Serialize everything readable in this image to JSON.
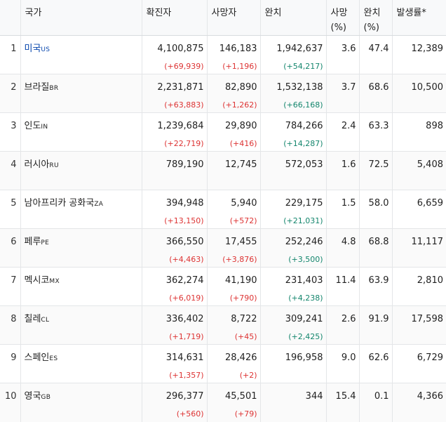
{
  "headers": {
    "country": "국가",
    "confirmed": "확진자",
    "deaths": "사망자",
    "recovered": "완치",
    "death_rate_1": "사망",
    "death_rate_2": "(%)",
    "recovery_rate_1": "완치",
    "recovery_rate_2": "(%)",
    "incidence": "발생률*"
  },
  "rows": [
    {
      "idx": "1",
      "name": "미국",
      "code": "US",
      "confirmed": "4,100,875",
      "confirmed_delta": "(+69,939)",
      "deaths": "146,183",
      "deaths_delta": "(+1,196)",
      "recovered": "1,942,637",
      "recovered_delta": "(+54,217)",
      "death_rate": "3.6",
      "recovery_rate": "47.4",
      "incidence": "12,389"
    },
    {
      "idx": "2",
      "name": "브라질",
      "code": "BR",
      "confirmed": "2,231,871",
      "confirmed_delta": "(+63,883)",
      "deaths": "82,890",
      "deaths_delta": "(+1,262)",
      "recovered": "1,532,138",
      "recovered_delta": "(+66,168)",
      "death_rate": "3.7",
      "recovery_rate": "68.6",
      "incidence": "10,500"
    },
    {
      "idx": "3",
      "name": "인도",
      "code": "IN",
      "confirmed": "1,239,684",
      "confirmed_delta": "(+22,719)",
      "deaths": "29,890",
      "deaths_delta": "(+416)",
      "recovered": "784,266",
      "recovered_delta": "(+14,287)",
      "death_rate": "2.4",
      "recovery_rate": "63.3",
      "incidence": "898"
    },
    {
      "idx": "4",
      "name": "러시아",
      "code": "RU",
      "confirmed": "789,190",
      "confirmed_delta": "",
      "deaths": "12,745",
      "deaths_delta": "",
      "recovered": "572,053",
      "recovered_delta": "",
      "death_rate": "1.6",
      "recovery_rate": "72.5",
      "incidence": "5,408"
    },
    {
      "idx": "5",
      "name": "남아프리카 공화국",
      "code": "ZA",
      "confirmed": "394,948",
      "confirmed_delta": "(+13,150)",
      "deaths": "5,940",
      "deaths_delta": "(+572)",
      "recovered": "229,175",
      "recovered_delta": "(+21,031)",
      "death_rate": "1.5",
      "recovery_rate": "58.0",
      "incidence": "6,659"
    },
    {
      "idx": "6",
      "name": "페루",
      "code": "PE",
      "confirmed": "366,550",
      "confirmed_delta": "(+4,463)",
      "deaths": "17,455",
      "deaths_delta": "(+3,876)",
      "recovered": "252,246",
      "recovered_delta": "(+3,500)",
      "death_rate": "4.8",
      "recovery_rate": "68.8",
      "incidence": "11,117"
    },
    {
      "idx": "7",
      "name": "멕시코",
      "code": "MX",
      "confirmed": "362,274",
      "confirmed_delta": "(+6,019)",
      "deaths": "41,190",
      "deaths_delta": "(+790)",
      "recovered": "231,403",
      "recovered_delta": "(+4,238)",
      "death_rate": "11.4",
      "recovery_rate": "63.9",
      "incidence": "2,810"
    },
    {
      "idx": "8",
      "name": "칠레",
      "code": "CL",
      "confirmed": "336,402",
      "confirmed_delta": "(+1,719)",
      "deaths": "8,722",
      "deaths_delta": "(+45)",
      "recovered": "309,241",
      "recovered_delta": "(+2,425)",
      "death_rate": "2.6",
      "recovery_rate": "91.9",
      "incidence": "17,598"
    },
    {
      "idx": "9",
      "name": "스페인",
      "code": "ES",
      "confirmed": "314,631",
      "confirmed_delta": "(+1,357)",
      "deaths": "28,426",
      "deaths_delta": "(+2)",
      "recovered": "196,958",
      "recovered_delta": "",
      "death_rate": "9.0",
      "recovery_rate": "62.6",
      "incidence": "6,729"
    },
    {
      "idx": "10",
      "name": "영국",
      "code": "GB",
      "confirmed": "296,377",
      "confirmed_delta": "(+560)",
      "deaths": "45,501",
      "deaths_delta": "(+79)",
      "recovered": "344",
      "recovered_delta": "",
      "death_rate": "15.4",
      "recovery_rate": "0.1",
      "incidence": "4,366"
    }
  ],
  "colors": {
    "link": "#0645ad",
    "increase": "#dd3333",
    "recovered_increase": "#14866d"
  }
}
